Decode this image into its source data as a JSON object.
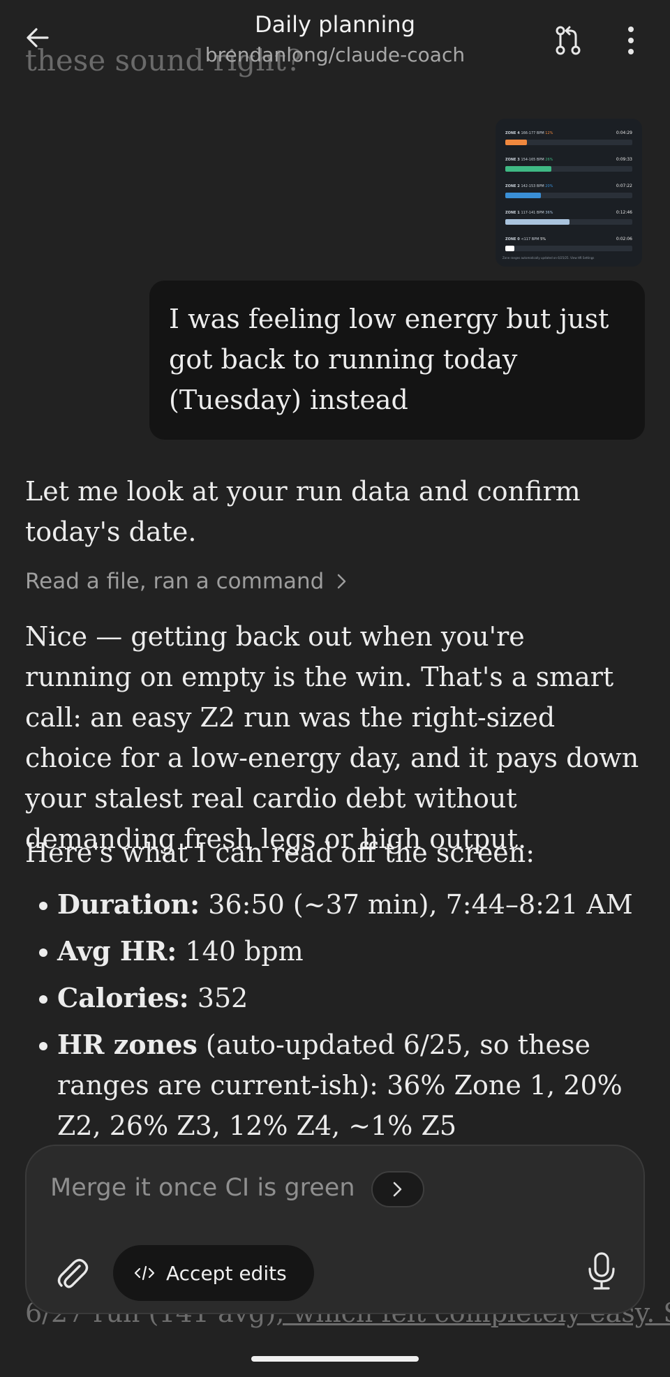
{
  "header": {
    "background_text": "these sound right?",
    "title": "Daily planning",
    "subtitle": "brendanlong/claude-coach"
  },
  "attachment": {
    "zones": [
      {
        "label": "ZONE 4",
        "range": "166-177 BPM",
        "pct": "12%",
        "time": "0:04:29",
        "fill": 0.12,
        "color": "#f0883e"
      },
      {
        "label": "ZONE 3",
        "range": "154-165 BPM",
        "pct": "26%",
        "time": "0:09:33",
        "fill": 0.26,
        "color": "#3fb984"
      },
      {
        "label": "ZONE 2",
        "range": "142-153 BPM",
        "pct": "20%",
        "time": "0:07:22",
        "fill": 0.2,
        "color": "#3a8fd6"
      },
      {
        "label": "ZONE 1",
        "range": "117-141 BPM",
        "pct": "36%",
        "time": "0:12:46",
        "fill": 0.36,
        "color": "#a9c3dd"
      },
      {
        "label": "ZONE 0",
        "range": "<117 BPM",
        "pct": "5%",
        "time": "0:02:06",
        "fill": 0.05,
        "color": "#ffffff"
      }
    ],
    "footer": "Zone ranges automatically updated on 6/25/25. View HR Settings"
  },
  "user_message": "I was feeling low energy but just got back to running today (Tuesday) instead",
  "assistant": {
    "intro": "Let me look at your run data and confirm today's date.",
    "tool_summary": "Read a file, ran a command",
    "paragraph": "Nice — getting back out when you're running on empty is the win. That's a smart call: an easy Z2 run was the right-sized choice for a low-energy day, and it pays down your stalest real cardio debt without demanding fresh legs or high output.",
    "read_intro": "Here's what I can read off the screen:",
    "bullets": [
      {
        "label": "Duration:",
        "text": " 36:50 (~37 min), 7:44–8:21 AM"
      },
      {
        "label": "Avg HR:",
        "text": " 140 bpm"
      },
      {
        "label": "Calories:",
        "text": " 352"
      },
      {
        "label": "HR zones",
        "text": " (auto-updated 6/25, so these ranges are current-ish): 36% Zone 1, 20% Z2, 26% Z3, 12% Z4, ~1% Z5"
      }
    ],
    "bottom_fragment_a": "6/27 run (141 avg)",
    "bottom_fragment_b": ", which felt completely easy. So"
  },
  "composer": {
    "placeholder": "Merge it once CI is green",
    "accept_label": "Accept edits"
  },
  "icons": {
    "back": "arrow-left-icon",
    "branch": "git-pull-request-icon",
    "more": "more-vertical-icon",
    "chevron": "chevron-right-icon",
    "attach": "paperclip-icon",
    "code": "code-icon",
    "mic": "microphone-icon"
  }
}
